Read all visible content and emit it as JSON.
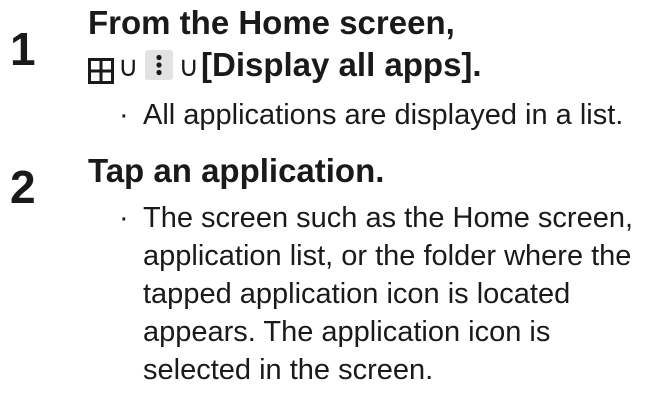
{
  "steps": [
    {
      "number": "1",
      "title_line1": "From the Home screen,",
      "title_icons": [
        "apps-grid-icon",
        "more-options-icon"
      ],
      "arrow": "∪",
      "title_line2_text": "[Display all apps].",
      "bullet_mark": "·",
      "bullet_lines": [
        "All applications are displayed in a list."
      ]
    },
    {
      "number": "2",
      "title_line1": "Tap an application.",
      "bullet_mark": "·",
      "bullet_lines": [
        "The screen such as the Home screen,",
        "application list, or the folder where the",
        "tapped application icon is located",
        "appears. The application icon is",
        "selected in the screen."
      ]
    }
  ]
}
